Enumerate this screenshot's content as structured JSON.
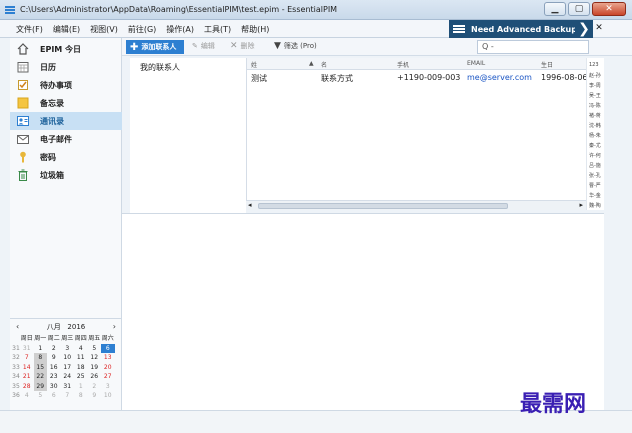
{
  "window": {
    "title": "C:\\Users\\Administrator\\AppData\\Roaming\\EssentialPIM\\test.epim - EssentialPIM"
  },
  "menu": [
    "文件(F)",
    "编辑(E)",
    "视图(V)",
    "前往(G)",
    "操作(A)",
    "工具(T)",
    "帮助(H)"
  ],
  "promo": {
    "label": "Need Advanced Backup?"
  },
  "sidebar": {
    "items": [
      {
        "label": "EPIM 今日",
        "icon": "home-icon"
      },
      {
        "label": "日历",
        "icon": "calendar-icon"
      },
      {
        "label": "待办事项",
        "icon": "checklist-icon"
      },
      {
        "label": "备忘录",
        "icon": "notes-icon"
      },
      {
        "label": "通讯录",
        "icon": "contacts-icon",
        "active": true
      },
      {
        "label": "电子邮件",
        "icon": "email-icon"
      },
      {
        "label": "密码",
        "icon": "key-icon"
      },
      {
        "label": "垃圾箱",
        "icon": "trash-icon"
      }
    ]
  },
  "toolbar": {
    "add_label": "添加联系人",
    "edit_label": "编辑",
    "delete_label": "删除",
    "filter_label": "筛选 (Pro)",
    "search_placeholder": "Q -"
  },
  "groups": {
    "item": "我的联系人"
  },
  "table": {
    "headers": [
      "姓",
      "名",
      "手机",
      "EMAIL",
      "生日"
    ],
    "rows": [
      {
        "last": "测试",
        "first": "联系方式",
        "mobile": "+1190-009-003",
        "email": "me@server.com",
        "birthday": "1996-08-06"
      }
    ]
  },
  "alpha_index": [
    "123",
    "赵-孙",
    "李-周",
    "吴-王",
    "冯-陈",
    "褚-蒋",
    "沈-韩",
    "杨-朱",
    "秦-尤",
    "许-何",
    "吕-施",
    "张-孔",
    "曹-严",
    "华-金",
    "魏-陶"
  ],
  "calendar": {
    "month": "八月",
    "year": "2016",
    "weekdays": [
      "周日",
      "周一",
      "周二",
      "周三",
      "周四",
      "周五",
      "周六"
    ],
    "weeks": [
      {
        "wk": "31",
        "days": [
          "31",
          "1",
          "2",
          "3",
          "4",
          "5",
          "6"
        ]
      },
      {
        "wk": "32",
        "days": [
          "7",
          "8",
          "9",
          "10",
          "11",
          "12",
          "13"
        ]
      },
      {
        "wk": "33",
        "days": [
          "14",
          "15",
          "16",
          "17",
          "18",
          "19",
          "20"
        ]
      },
      {
        "wk": "34",
        "days": [
          "21",
          "22",
          "23",
          "24",
          "25",
          "26",
          "27"
        ]
      },
      {
        "wk": "35",
        "days": [
          "28",
          "29",
          "30",
          "31",
          "1",
          "2",
          "3"
        ]
      },
      {
        "wk": "36",
        "days": [
          "4",
          "5",
          "6",
          "7",
          "8",
          "9",
          "10"
        ]
      }
    ],
    "today": "6"
  },
  "watermark": "最需网",
  "colors": {
    "accent": "#2d7fd1",
    "promo": "#1f4f77",
    "active": "#c8e0f4",
    "weekend": "#dd2222"
  }
}
